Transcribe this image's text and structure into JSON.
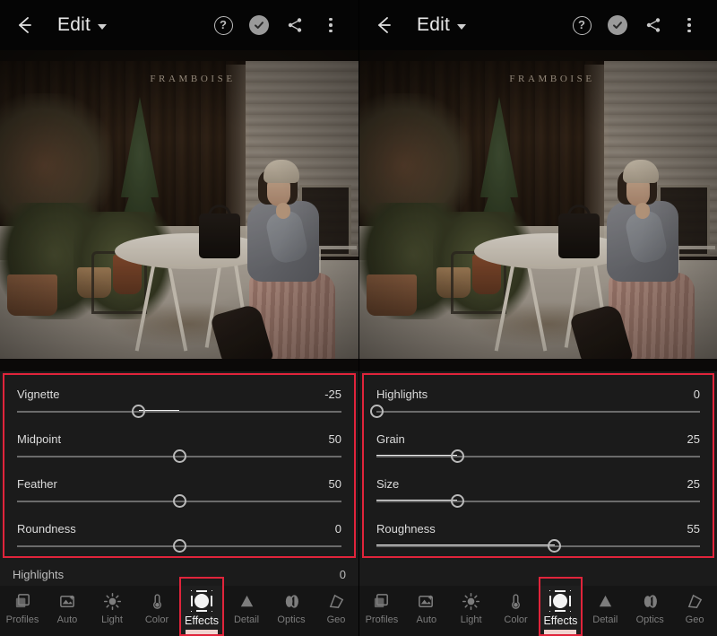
{
  "app": {
    "name": "Adobe Lightroom Mobile Editor",
    "accent_red": "#e0243b",
    "panel_bg": "#1b1b1b",
    "bar_bg": "#151515"
  },
  "header": {
    "title": "Edit",
    "back_icon": "back-arrow-icon",
    "caret_icon": "chevron-down-icon",
    "help_icon": "help-circle-icon",
    "help_glyph": "?",
    "done_icon": "check-circle-icon",
    "share_icon": "share-icon",
    "more_icon": "overflow-menu-icon"
  },
  "photo": {
    "sign_text": "FRAMBOISE",
    "description": "Woman sitting at an outdoor cafe terrace with wooden wall, potted plants and white bistro table"
  },
  "left_panel": {
    "sliders": [
      {
        "label": "Vignette",
        "value": "-25",
        "num": -25,
        "min": -100,
        "max": 100,
        "thumb_pct": 37.5,
        "fill_from_pct": 37.5,
        "fill_to_pct": 50
      },
      {
        "label": "Midpoint",
        "value": "50",
        "num": 50,
        "min": 0,
        "max": 100,
        "thumb_pct": 50,
        "fill_from_pct": 50,
        "fill_to_pct": 50
      },
      {
        "label": "Feather",
        "value": "50",
        "num": 50,
        "min": 0,
        "max": 100,
        "thumb_pct": 50,
        "fill_from_pct": 50,
        "fill_to_pct": 50
      },
      {
        "label": "Roundness",
        "value": "0",
        "num": 0,
        "min": -100,
        "max": 100,
        "thumb_pct": 50,
        "fill_from_pct": 50,
        "fill_to_pct": 50
      }
    ],
    "peek_row": {
      "label": "Highlights",
      "value": "0"
    }
  },
  "right_panel": {
    "sliders": [
      {
        "label": "Highlights",
        "value": "0",
        "num": 0,
        "min": 0,
        "max": 100,
        "thumb_pct": 0,
        "fill_from_pct": 0,
        "fill_to_pct": 0
      },
      {
        "label": "Grain",
        "value": "25",
        "num": 25,
        "min": 0,
        "max": 100,
        "thumb_pct": 25,
        "fill_from_pct": 0,
        "fill_to_pct": 25
      },
      {
        "label": "Size",
        "value": "25",
        "num": 25,
        "min": 0,
        "max": 100,
        "thumb_pct": 25,
        "fill_from_pct": 0,
        "fill_to_pct": 25
      },
      {
        "label": "Roughness",
        "value": "55",
        "num": 55,
        "min": 0,
        "max": 100,
        "thumb_pct": 55,
        "fill_from_pct": 0,
        "fill_to_pct": 55
      }
    ],
    "peek_row": {
      "label": "",
      "value": ""
    }
  },
  "toolbar": {
    "active_index": 4,
    "tabs": [
      {
        "label": "Profiles",
        "icon": "profiles-icon"
      },
      {
        "label": "Auto",
        "icon": "auto-icon"
      },
      {
        "label": "Light",
        "icon": "light-sun-icon"
      },
      {
        "label": "Color",
        "icon": "color-thermometer-icon"
      },
      {
        "label": "Effects",
        "icon": "effects-vignette-icon"
      },
      {
        "label": "Detail",
        "icon": "detail-triangle-icon"
      },
      {
        "label": "Optics",
        "icon": "optics-lens-icon"
      },
      {
        "label": "Geo",
        "icon": "geometry-icon"
      }
    ]
  }
}
